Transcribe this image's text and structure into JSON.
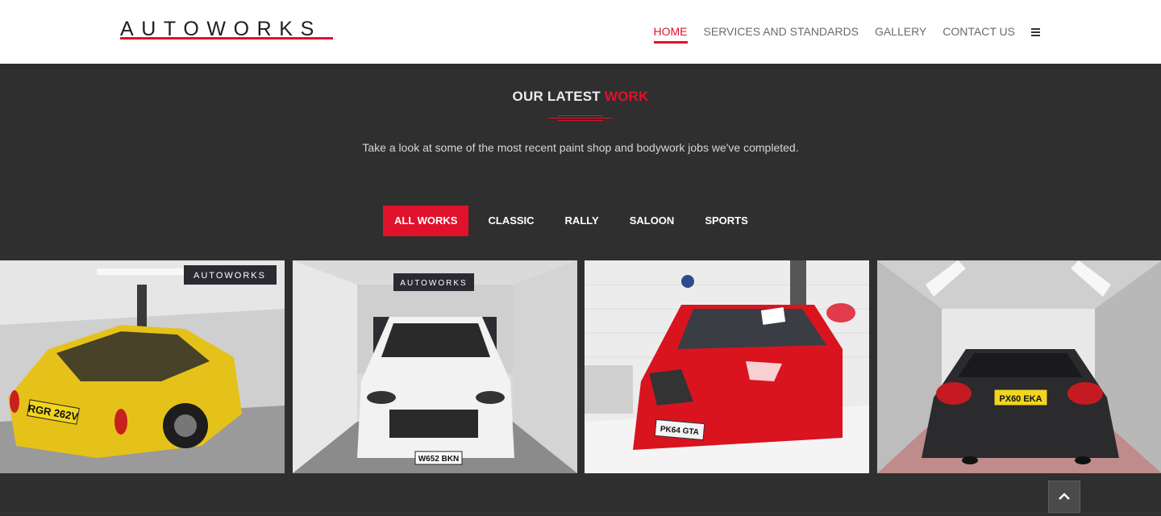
{
  "brand": {
    "logo_text": "AUTOWORKS",
    "accent_color": "#e0112b"
  },
  "nav": {
    "items": [
      {
        "label": "HOME",
        "active": true
      },
      {
        "label": "SERVICES AND STANDARDS",
        "active": false
      },
      {
        "label": "GALLERY",
        "active": false
      },
      {
        "label": "CONTACT US",
        "active": false
      }
    ],
    "menu_icon": "hamburger-icon"
  },
  "section": {
    "title_main": "OUR LATEST ",
    "title_accent": "WORK",
    "subtitle": "Take a look at some of the most recent paint shop and bodywork jobs we've completed."
  },
  "filters": [
    {
      "label": "ALL WORKS",
      "active": true
    },
    {
      "label": "CLASSIC",
      "active": false
    },
    {
      "label": "RALLY",
      "active": false
    },
    {
      "label": "SALOON",
      "active": false
    },
    {
      "label": "SPORTS",
      "active": false
    }
  ],
  "gallery": [
    {
      "car_color": "#e5c21a",
      "plate": "RGR 262V",
      "booth_sign": "AUTOWORKS"
    },
    {
      "car_color": "#f2f2f2",
      "plate": "W652 BKN",
      "booth_sign": "AUTOWORKS"
    },
    {
      "car_color": "#d9141e",
      "plate": "PK64 GTA",
      "booth_sign": ""
    },
    {
      "car_color": "#2b2b2e",
      "plate": "PX60 EKA",
      "booth_sign": ""
    }
  ],
  "back_to_top_icon": "chevron-up-icon"
}
